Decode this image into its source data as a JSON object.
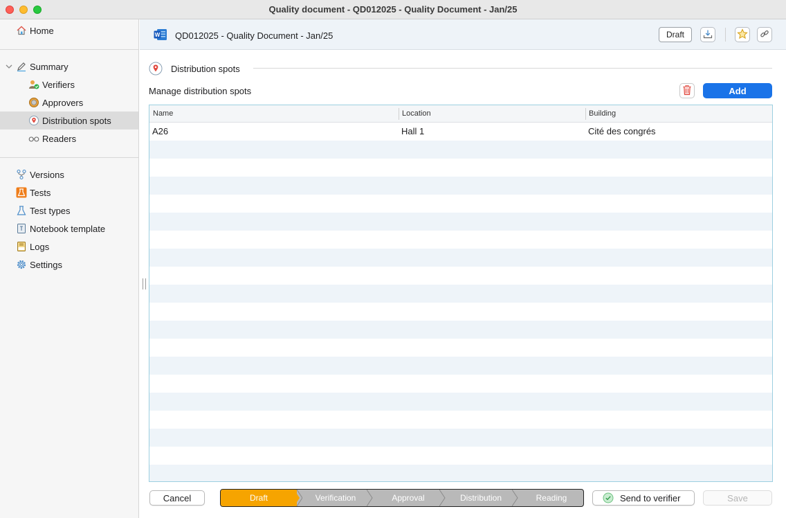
{
  "window": {
    "title": "Quality document - QD012025 - Quality Document - Jan/25"
  },
  "sidebar": {
    "home": {
      "label": "Home",
      "icon": "home-icon"
    },
    "summary": {
      "label": "Summary",
      "icon": "pencil-icon",
      "expanded": true
    },
    "summary_children": [
      {
        "label": "Verifiers",
        "icon": "verifier-user-icon"
      },
      {
        "label": "Approvers",
        "icon": "approver-seal-icon"
      },
      {
        "label": "Distribution spots",
        "icon": "location-pin-icon",
        "selected": true
      },
      {
        "label": "Readers",
        "icon": "glasses-icon"
      }
    ],
    "other_items": [
      {
        "label": "Versions",
        "icon": "versions-branch-icon"
      },
      {
        "label": "Tests",
        "icon": "flask-icon"
      },
      {
        "label": "Test types",
        "icon": "flask-outline-icon"
      },
      {
        "label": "Notebook template",
        "icon": "notebook-icon"
      },
      {
        "label": "Logs",
        "icon": "logs-icon"
      },
      {
        "label": "Settings",
        "icon": "gear-icon"
      }
    ]
  },
  "header": {
    "doc_icon": "word-document-icon",
    "title": "QD012025 - Quality Document - Jan/25",
    "status_badge": "Draft",
    "buttons": [
      "download-icon",
      "favorite-star-icon",
      "link-icon"
    ]
  },
  "section": {
    "title": "Distribution spots",
    "icon": "location-pin-icon",
    "subtitle": "Manage distribution spots",
    "add_label": "Add",
    "delete_icon": "trash-icon"
  },
  "table": {
    "columns": [
      "Name",
      "Location",
      "Building"
    ],
    "rows": [
      [
        "A26",
        "Hall 1",
        "Cité des congrés"
      ]
    ]
  },
  "footer": {
    "cancel_label": "Cancel",
    "workflow_steps": [
      "Draft",
      "Verification",
      "Approval",
      "Distribution",
      "Reading"
    ],
    "workflow_current": "Draft",
    "send_label": "Send to verifier",
    "save_label": "Save"
  },
  "colors": {
    "accent": "#1a73e8",
    "workflow_active": "#f6a400",
    "workflow_inactive": "#b9b9b9",
    "row_alt": "#eef4f9",
    "table_border": "#9ccfe0"
  }
}
